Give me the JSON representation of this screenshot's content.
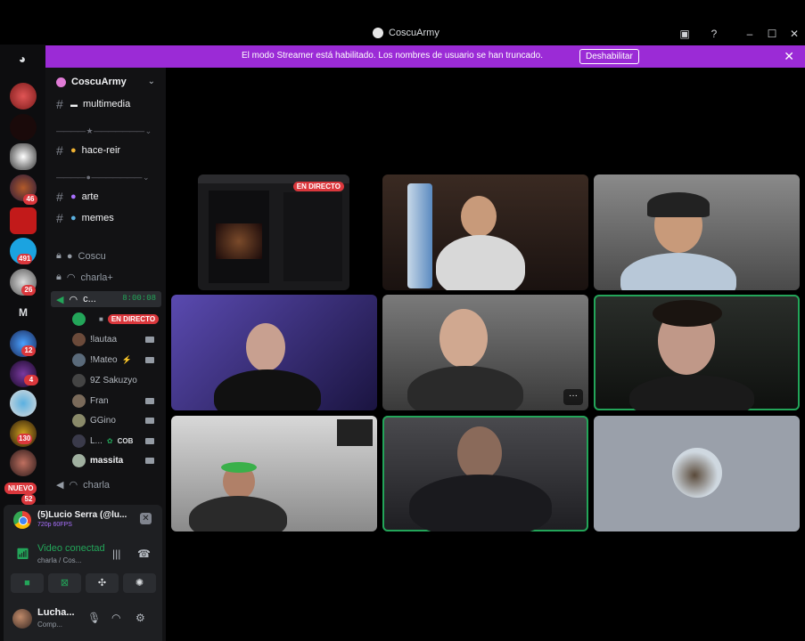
{
  "window": {
    "title": "CoscuArmy"
  },
  "banner": {
    "message": "El modo Streamer está habilitado. Los nombres de usuario se han truncado.",
    "disable_label": "Deshabilitar"
  },
  "rail": {
    "badges": [
      "46",
      "491",
      "26",
      "12",
      "4",
      "130",
      "52"
    ],
    "letter_server": "M",
    "nuevo_label": "NUEVO"
  },
  "guild": {
    "name": "CoscuArmy"
  },
  "channels": {
    "multimedia": "multimedia",
    "hace_reir": "hace-reir",
    "arte": "arte",
    "memes": "memes",
    "coscu": "Coscu",
    "charla_plus": "charla+",
    "active_voice": "c...",
    "active_timer": "8:00:08",
    "charla": "charla"
  },
  "voice_users": {
    "live_label": "EN DIRECTO",
    "u1": "!lautaa",
    "u2": "!Mateo",
    "u3": "9Z Sakuzyo",
    "u4": "Fran",
    "u5": "GGino",
    "u6": "L...",
    "u6_tag": "COB",
    "u7": "massita"
  },
  "panel": {
    "stream_title": "(5)Lucio Serra (@lu...",
    "stream_sub": "720p 60FPS",
    "vc_status": "Video conectad",
    "vc_sub": "charla / Cos...",
    "me_name": "Lucha...",
    "me_status": "Comp..."
  },
  "stage": {
    "live_label": "EN DIRECTO",
    "more_label": "···"
  },
  "colors": {
    "accent_green": "#23a559",
    "live_red": "#da373c",
    "banner_purple": "#9b2bd6"
  }
}
